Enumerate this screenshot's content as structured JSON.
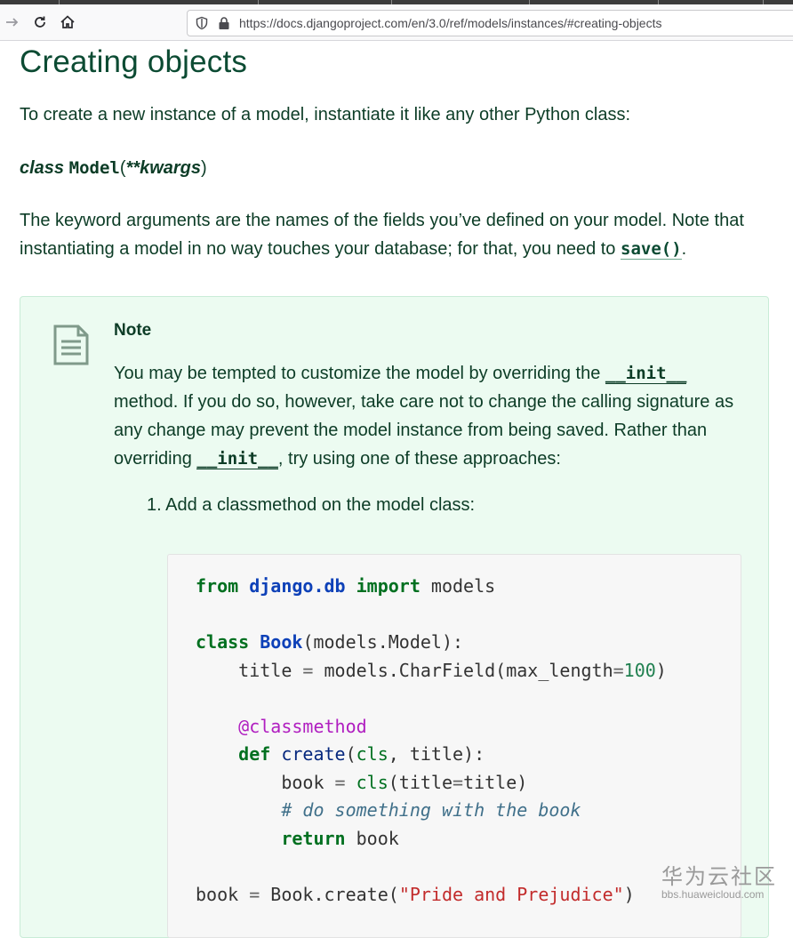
{
  "browser": {
    "url": "https://docs.djangoproject.com/en/3.0/ref/models/instances/#creating-objects"
  },
  "page": {
    "title": "Creating objects",
    "intro": "To create a new instance of a model, instantiate it like any other Python class:",
    "signature": {
      "keyword": "class",
      "name": "Model",
      "open": "(",
      "args": "**kwargs",
      "close": ")"
    },
    "para2_before": "The keyword arguments are the names of the fields you’ve defined on your model. Note that instantiating a model in no way touches your database; for that, you need to ",
    "para2_link": "save()",
    "para2_after": "."
  },
  "note": {
    "title": "Note",
    "text_1": "You may be tempted to customize the model by overriding the ",
    "code_1": "__init__",
    "text_2": " method. If you do so, however, take care not to change the calling signature as any change may prevent the model instance from being saved. Rather than overriding ",
    "code_2": "__init__",
    "text_3": ", try using one of these approaches:",
    "list_item_1": "1. Add a classmethod on the model class:"
  },
  "code": {
    "line1": [
      "from",
      " ",
      "django.db",
      " ",
      "import",
      " models"
    ],
    "line3": [
      "class",
      " ",
      "Book",
      "(models.Model):"
    ],
    "line4": [
      "    title ",
      "=",
      " models.CharField(max_length",
      "=",
      "100",
      ")"
    ],
    "line6": [
      "    ",
      "@classmethod"
    ],
    "line7": [
      "    ",
      "def",
      " ",
      "create",
      "(",
      "cls",
      ", title):"
    ],
    "line8": [
      "        book ",
      "=",
      " ",
      "cls",
      "(title",
      "=",
      "title)"
    ],
    "line9": [
      "        ",
      "# do something with the book"
    ],
    "line10": [
      "        ",
      "return",
      " book"
    ],
    "line12": [
      "book ",
      "=",
      " Book.create(",
      "\"Pride and Prejudice\"",
      ")"
    ]
  },
  "watermark": {
    "brand": "华为云社区",
    "site": "bbs.huaweicloud.com"
  }
}
